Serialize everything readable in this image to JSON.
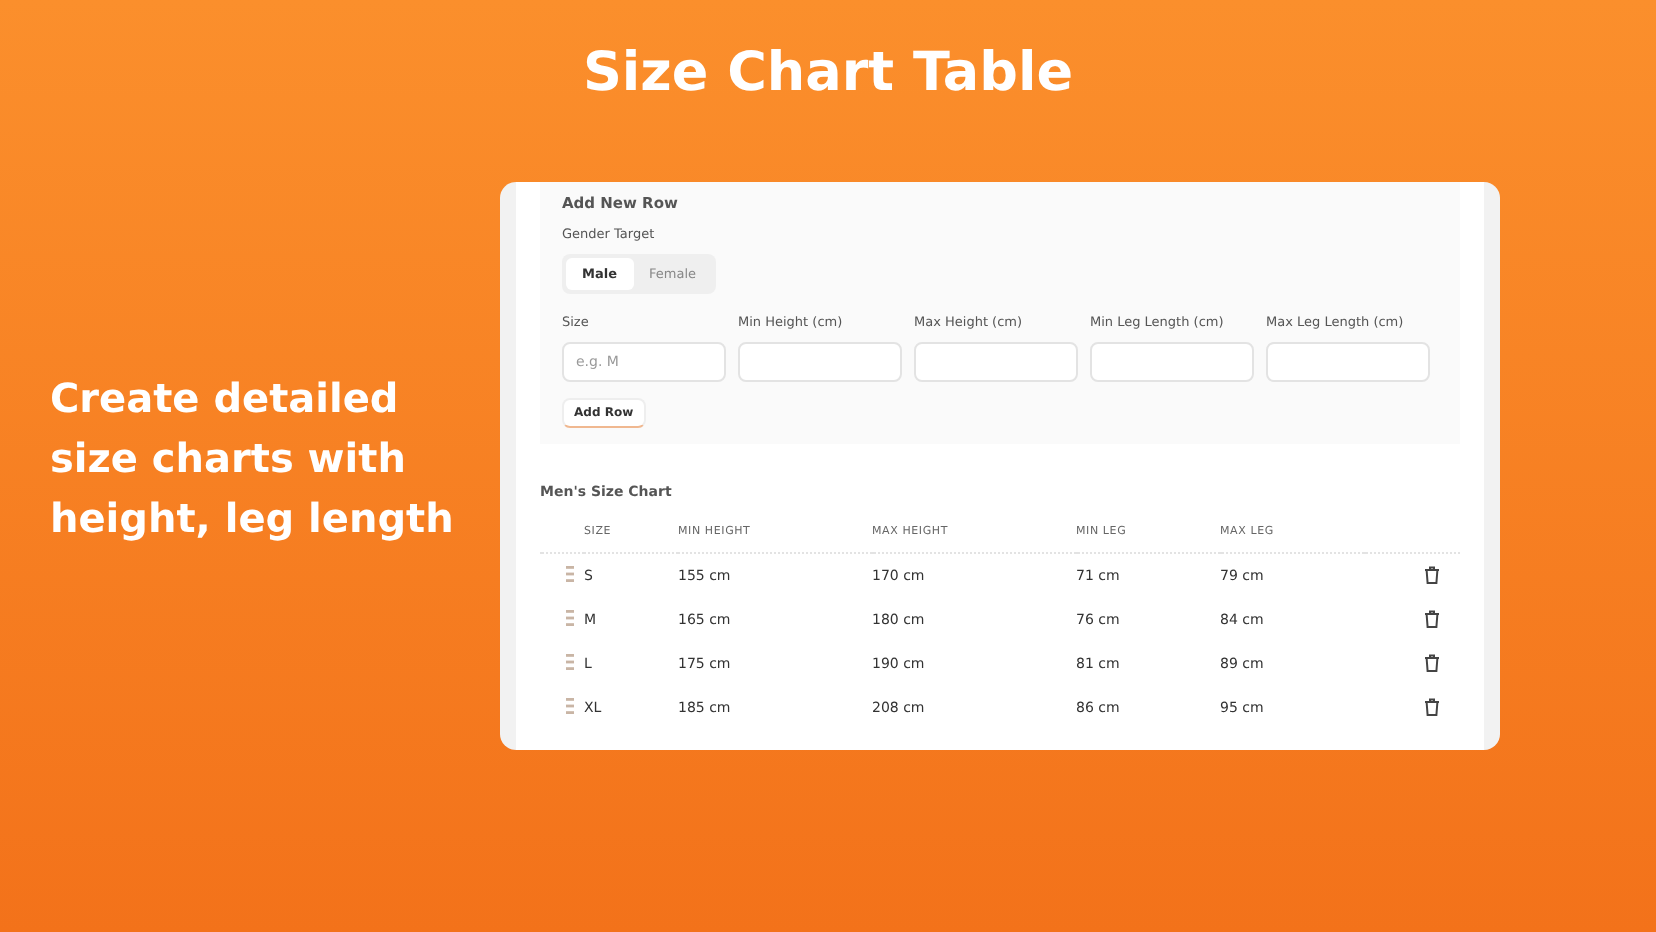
{
  "headline": "Size Chart Table",
  "tagline": "Create detailed size charts with height, leg length",
  "form": {
    "title": "Add New Row",
    "gender_label": "Gender Target",
    "genders": [
      {
        "label": "Male",
        "selected": true
      },
      {
        "label": "Female",
        "selected": false
      }
    ],
    "fields": [
      {
        "label": "Size",
        "placeholder": "e.g. M"
      },
      {
        "label": "Min Height (cm)"
      },
      {
        "label": "Max Height (cm)"
      },
      {
        "label": "Min Leg Length (cm)"
      },
      {
        "label": "Max Leg Length (cm)"
      }
    ],
    "button": "Add Row"
  },
  "table": {
    "title": "Men's Size Chart",
    "columns": [
      "SIZE",
      "MIN HEIGHT",
      "MAX HEIGHT",
      "MIN LEG",
      "MAX LEG"
    ],
    "rows": [
      [
        "S",
        "155 cm",
        "170 cm",
        "71 cm",
        "79 cm"
      ],
      [
        "M",
        "165 cm",
        "180 cm",
        "76 cm",
        "84 cm"
      ],
      [
        "L",
        "175 cm",
        "190 cm",
        "81 cm",
        "89 cm"
      ],
      [
        "XL",
        "185 cm",
        "208 cm",
        "86 cm",
        "95 cm"
      ]
    ]
  }
}
